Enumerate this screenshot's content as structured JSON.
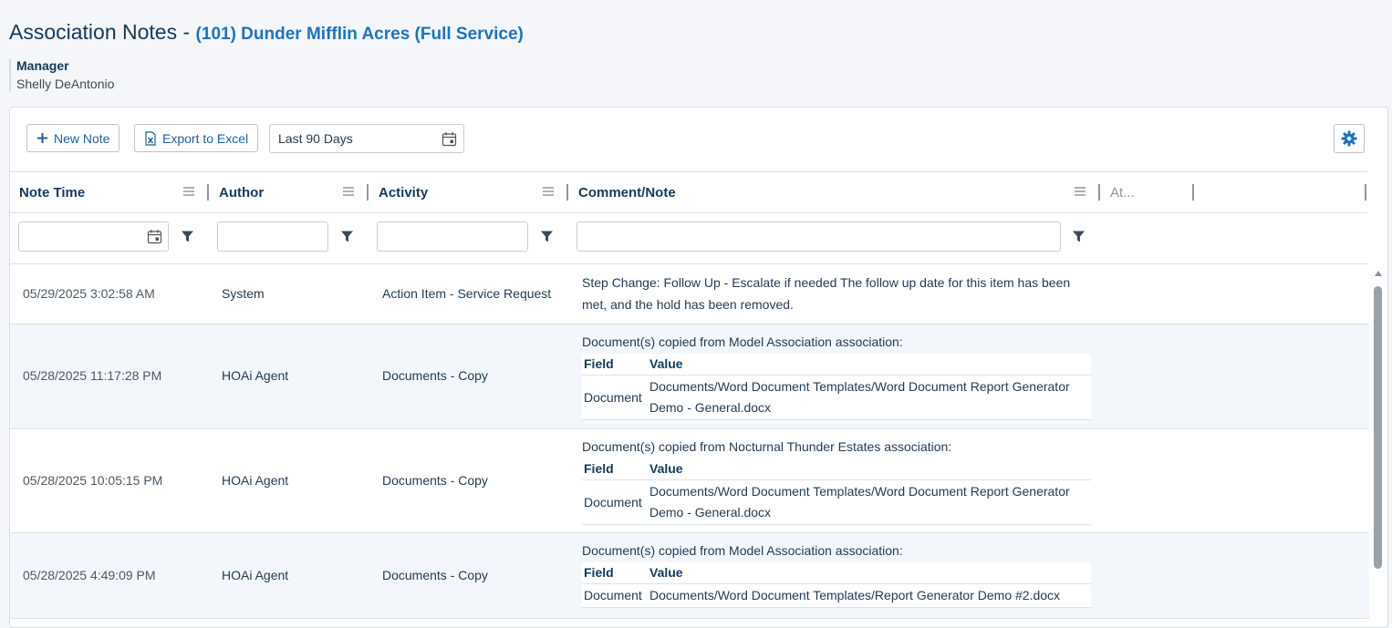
{
  "page": {
    "title": "Association Notes",
    "title_separator": " - ",
    "association": "(101) Dunder Mifflin Acres (Full Service)",
    "manager_label": "Manager",
    "manager_name": "Shelly DeAntonio"
  },
  "toolbar": {
    "new_note_label": "New Note",
    "export_label": "Export to Excel",
    "date_range_value": "Last 90 Days"
  },
  "columns": [
    {
      "label": "Note Time"
    },
    {
      "label": "Author"
    },
    {
      "label": "Activity"
    },
    {
      "label": "Comment/Note"
    },
    {
      "label": "At..."
    }
  ],
  "rows": [
    {
      "time": "05/29/2025 3:02:58 AM",
      "author": "System",
      "activity": "Action Item - Service Request",
      "note": "Step Change: Follow Up - Escalate if needed The follow up date for this item has been met, and the hold has been removed."
    },
    {
      "time": "05/28/2025 11:17:28 PM",
      "author": "HOAi Agent",
      "activity": "Documents - Copy",
      "note": "Document(s) copied from Model Association association:",
      "table": {
        "field_header": "Field",
        "value_header": "Value",
        "field": "Document",
        "value": "Documents/Word Document Templates/Word Document Report Generator Demo - General.docx"
      }
    },
    {
      "time": "05/28/2025 10:05:15 PM",
      "author": "HOAi Agent",
      "activity": "Documents - Copy",
      "note": "Document(s) copied from Nocturnal Thunder Estates association:",
      "table": {
        "field_header": "Field",
        "value_header": "Value",
        "field": "Document",
        "value": "Documents/Word Document Templates/Word Document Report Generator Demo - General.docx"
      }
    },
    {
      "time": "05/28/2025 4:49:09 PM",
      "author": "HOAi Agent",
      "activity": "Documents - Copy",
      "note": "Document(s) copied from Model Association association:",
      "table": {
        "field_header": "Field",
        "value_header": "Value",
        "field": "Document",
        "value": "Documents/Word Document Templates/Report Generator Demo #2.docx"
      }
    }
  ],
  "colors": {
    "accent": "#1d74bc",
    "heading": "#15395c",
    "alt_row": "#f3f7fb"
  },
  "icons": [
    "plus-icon",
    "excel-icon",
    "calendar-icon",
    "gear-icon",
    "column-menu-icon",
    "filter-icon",
    "scroll-up-icon"
  ]
}
